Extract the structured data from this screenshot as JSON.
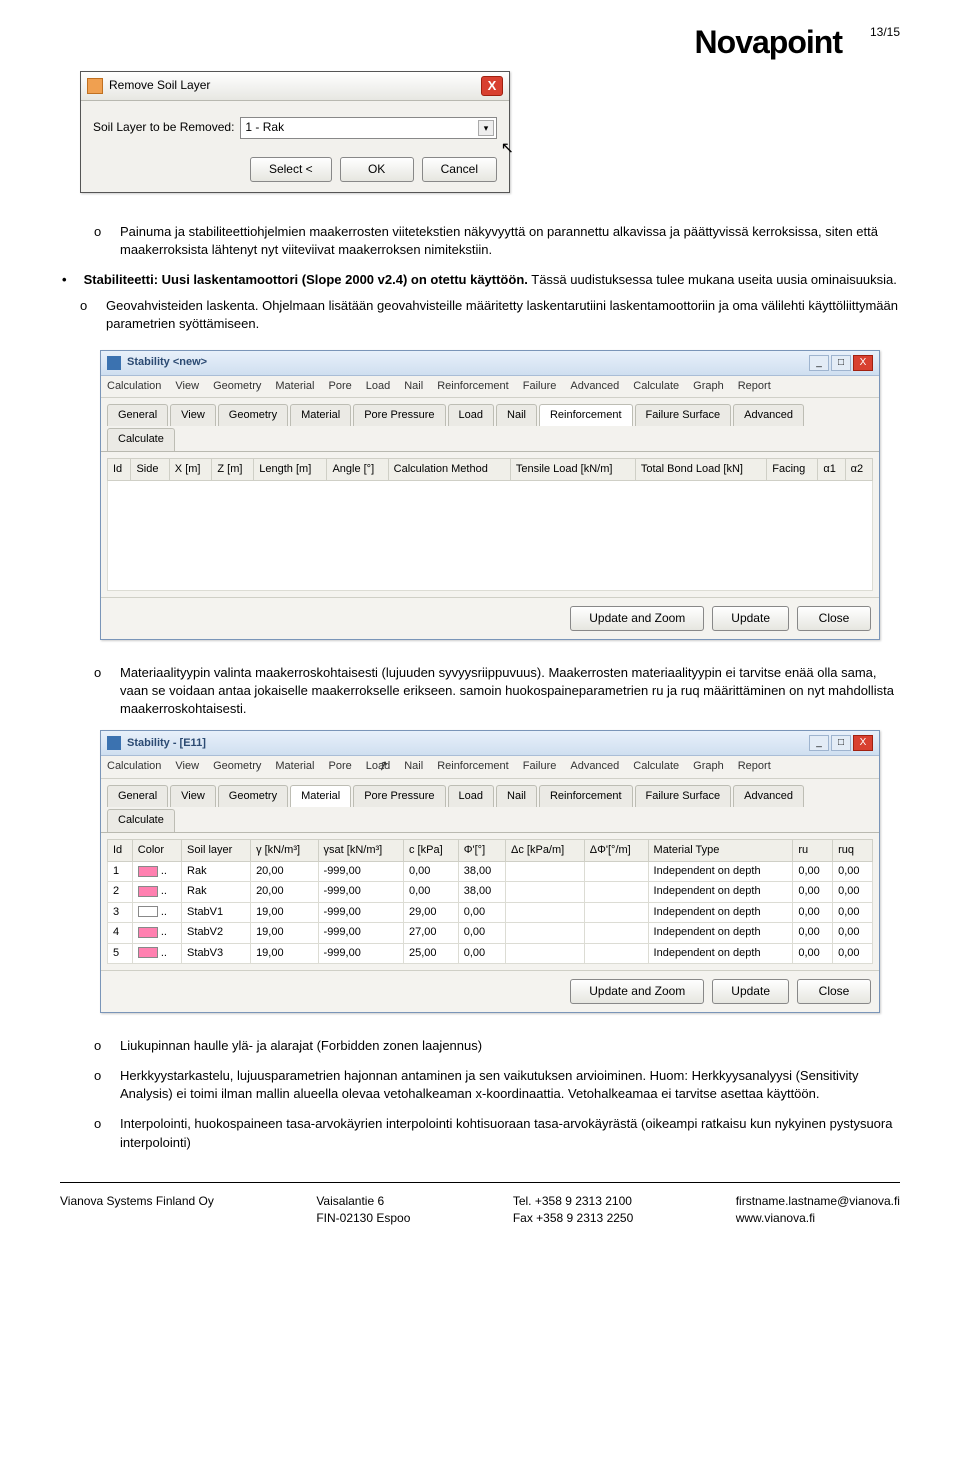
{
  "header": {
    "logo": "Novapoint",
    "page_num": "13/15"
  },
  "dialog1": {
    "title": "Remove Soil Layer",
    "field_label": "Soil Layer to be Removed:",
    "field_value": "1 - Rak",
    "btn_select": "Select <",
    "btn_ok": "OK",
    "btn_cancel": "Cancel"
  },
  "doc": {
    "p1_marker": "o",
    "p1": "Painuma ja stabiliteettiohjelmien maakerrosten viitetekstien näkyvyyttä on parannettu alkavissa ja päättyvissä kerroksissa, siten että maakerroksista lähtenyt nyt viiteviivat maakerroksen nimitekstiin.",
    "p2": "Stabiliteetti: Uusi laskentamoottori (Slope 2000 v2.4) on otettu käyttöön.",
    "p2b": " Tässä uudistuksessa tulee mukana useita uusia ominaisuuksia.",
    "s1_marker": "o",
    "s1": "Geovahvisteiden laskenta. Ohjelmaan lisätään geovahvisteille määritetty laskentarutiini laskentamoottoriin ja oma välilehti käyttöliittymään parametrien syöttämiseen.",
    "s2_marker": "o",
    "s2": "Materiaalityypin valinta maakerroskohtaisesti (lujuuden syvyysriippuvuus). Maakerrosten materiaalityypin ei tarvitse enää olla sama, vaan se voidaan antaa jokaiselle maakerrokselle erikseen. samoin huokospaineparametrien ru ja ruq määrittäminen on nyt mahdollista maakerroskohtaisesti.",
    "s3_marker": "o",
    "s3": "Liukupinnan haulle ylä- ja alarajat (Forbidden zonen laajennus)",
    "s4_marker": "o",
    "s4": "Herkkyystarkastelu, lujuusparametrien hajonnan antaminen ja sen vaikutuksen arvioiminen. Huom: Herkkyysanalyysi (Sensitivity Analysis) ei toimi ilman mallin alueella olevaa vetohalkeaman x-koordinaattia. Vetohalkeamaa ei tarvitse asettaa käyttöön.",
    "s5_marker": "o",
    "s5": "Interpolointi, huokospaineen tasa-arvokäyrien interpolointi kohtisuoraan tasa-arvokäyrästä (oikeampi ratkaisu kun nykyinen pystysuora interpolointi)"
  },
  "win1": {
    "title": "Stability <new>",
    "menu": [
      "Calculation",
      "View",
      "Geometry",
      "Material",
      "Pore",
      "Load",
      "Nail",
      "Reinforcement",
      "Failure",
      "Advanced",
      "Calculate",
      "Graph",
      "Report"
    ],
    "tabs": [
      "General",
      "View",
      "Geometry",
      "Material",
      "Pore Pressure",
      "Load",
      "Nail",
      "Reinforcement",
      "Failure Surface",
      "Advanced",
      "Calculate"
    ],
    "active_tab_index": 7,
    "headers": [
      "Id",
      "Side",
      "X [m]",
      "Z [m]",
      "Length [m]",
      "Angle [°]",
      "Calculation Method",
      "Tensile Load [kN/m]",
      "Total Bond Load [kN]",
      "Facing",
      "α1",
      "α2"
    ],
    "btn_uz": "Update and Zoom",
    "btn_u": "Update",
    "btn_c": "Close"
  },
  "win2": {
    "title": "Stability - [E11]",
    "menu": [
      "Calculation",
      "View",
      "Geometry",
      "Material",
      "Pore",
      "Load",
      "Nail",
      "Reinforcement",
      "Failure",
      "Advanced",
      "Calculate",
      "Graph",
      "Report"
    ],
    "tabs": [
      "General",
      "View",
      "Geometry",
      "Material",
      "Pore Pressure",
      "Load",
      "Nail",
      "Reinforcement",
      "Failure Surface",
      "Advanced",
      "Calculate"
    ],
    "active_tab_index": 3,
    "headers": [
      "Id",
      "Color",
      "Soil layer",
      "γ [kN/m³]",
      "γsat [kN/m³]",
      "c [kPa]",
      "Φ'[°]",
      "Δc [kPa/m]",
      "ΔΦ'[°/m]",
      "Material Type",
      "ru",
      "ruq"
    ],
    "rows": [
      {
        "id": "1",
        "color": "#ff80b0",
        "soil": "Rak",
        "g": "20,00",
        "gs": "-999,00",
        "c": "0,00",
        "phi": "38,00",
        "dc": "",
        "dphi": "",
        "mt": "Independent on depth",
        "ru": "0,00",
        "ruq": "0,00"
      },
      {
        "id": "2",
        "color": "#ff80b0",
        "soil": "Rak",
        "g": "20,00",
        "gs": "-999,00",
        "c": "0,00",
        "phi": "38,00",
        "dc": "",
        "dphi": "",
        "mt": "Independent on depth",
        "ru": "0,00",
        "ruq": "0,00"
      },
      {
        "id": "3",
        "color": "#ffffff",
        "soil": "StabV1",
        "g": "19,00",
        "gs": "-999,00",
        "c": "29,00",
        "phi": "0,00",
        "dc": "",
        "dphi": "",
        "mt": "Independent on depth",
        "ru": "0,00",
        "ruq": "0,00"
      },
      {
        "id": "4",
        "color": "#ff80b0",
        "soil": "StabV2",
        "g": "19,00",
        "gs": "-999,00",
        "c": "27,00",
        "phi": "0,00",
        "dc": "",
        "dphi": "",
        "mt": "Independent on depth",
        "ru": "0,00",
        "ruq": "0,00"
      },
      {
        "id": "5",
        "color": "#ff80b0",
        "soil": "StabV3",
        "g": "19,00",
        "gs": "-999,00",
        "c": "25,00",
        "phi": "0,00",
        "dc": "",
        "dphi": "",
        "mt": "Independent on depth",
        "ru": "0,00",
        "ruq": "0,00"
      }
    ],
    "btn_uz": "Update and Zoom",
    "btn_u": "Update",
    "btn_c": "Close"
  },
  "footer": {
    "c1a": "Vianova Systems Finland Oy",
    "c2a": "Vaisalantie 6",
    "c2b": "FIN-02130 Espoo",
    "c3a": "Tel. +358 9 2313 2100",
    "c3b": "Fax +358 9 2313 2250",
    "c4a": "firstname.lastname@vianova.fi",
    "c4b": "www.vianova.fi"
  }
}
